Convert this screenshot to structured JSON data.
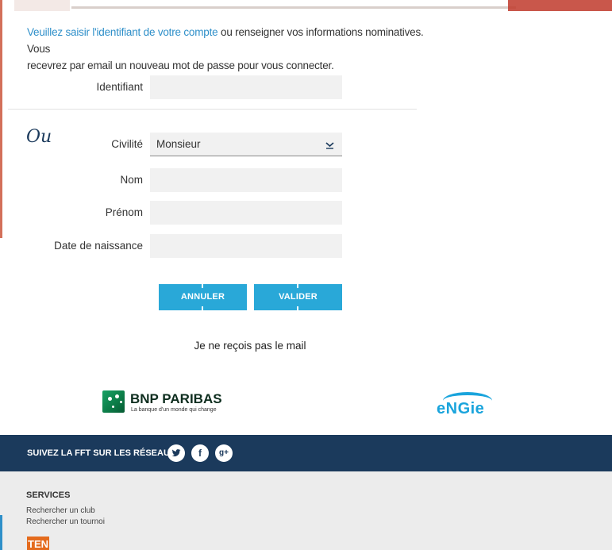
{
  "intro": {
    "link_text": "Veuillez saisir l'identifiant de votre compte",
    "text_line1": " ou renseigner vos informations nominatives. Vous",
    "text_line2": "recevrez par email un nouveau mot de passe pour vous connecter."
  },
  "identifiant": {
    "label": "Identifiant",
    "value": ""
  },
  "ou_label": "Ou",
  "form": {
    "civilite": {
      "label": "Civilité",
      "selected": "Monsieur"
    },
    "nom": {
      "label": "Nom",
      "value": ""
    },
    "prenom": {
      "label": "Prénom",
      "value": ""
    },
    "date_naissance": {
      "label": "Date de naissance",
      "value": ""
    }
  },
  "buttons": {
    "cancel_label": "ANNULER",
    "submit_label": "VALIDER"
  },
  "no_mail_link": "Je ne reçois pas le mail",
  "sponsors": {
    "bnp_name": "BNP PARIBAS",
    "bnp_tagline": "La banque d'un monde qui change",
    "engie_name": "eNGie"
  },
  "social": {
    "title": "SUIVEZ LA FFT SUR LES RÉSEAUX :",
    "icons": [
      "twitter-icon",
      "facebook-icon",
      "google-plus-icon"
    ],
    "facebook_glyph": "f",
    "gplus_glyph": "g+"
  },
  "services": {
    "heading": "SERVICES",
    "links": [
      "Rechercher un club",
      "Rechercher un tournoi"
    ],
    "logo_text": "TEN"
  },
  "colors": {
    "accent_blue": "#29a8d8",
    "link_blue": "#2e8fc9",
    "navy": "#1b3a5c",
    "bnp_green": "#18a164",
    "engie_blue": "#1aa4dc"
  }
}
